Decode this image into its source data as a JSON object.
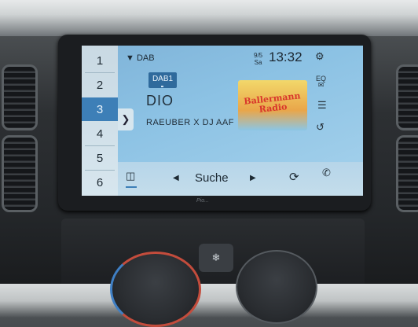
{
  "presets": [
    "1",
    "2",
    "3",
    "4",
    "5",
    "6"
  ],
  "active_preset": "3",
  "header": {
    "source_label": "DAB",
    "date_top": "9/5",
    "date_bottom": "Sa",
    "time": "13:32"
  },
  "station": {
    "band": "DAB1",
    "name": "DIO",
    "now_playing": "RAEUBER X DJ AAF",
    "logo_text": "Ballermann Radio"
  },
  "bottom_bar": {
    "seek_label": "Suche"
  },
  "side_icons": {
    "eq_label": "EQ"
  },
  "bezel_brand": "Pio...",
  "icons": [
    "dropdown-arrow-icon",
    "gear-icon",
    "eq-icon",
    "list-icon",
    "history-icon",
    "media-source-icon",
    "prev-arrow-icon",
    "next-arrow-icon",
    "refresh-icon",
    "phone-icon",
    "chevron-right-icon",
    "fan-icon"
  ],
  "colors": {
    "active_preset_bg": "#3d7fb7",
    "band_badge_bg": "#2f6a9c"
  }
}
